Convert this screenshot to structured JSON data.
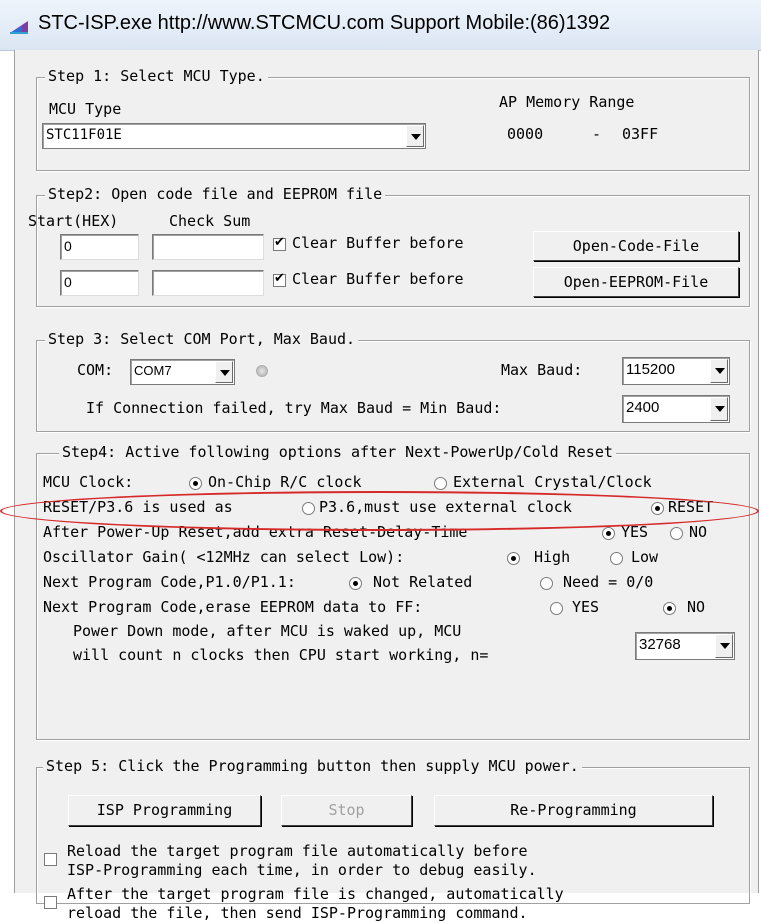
{
  "window": {
    "title": "STC-ISP.exe  http://www.STCMCU.com  Support Mobile:(86)1392",
    "icon": "stc-app-icon"
  },
  "step1": {
    "legend": "Step 1: Select MCU Type.",
    "mcu_type_label": "MCU Type",
    "mcu_type_value": "STC11F01E",
    "ap_memory_label": "AP Memory Range",
    "ap_start": "0000",
    "ap_dash": "-",
    "ap_end": "03FF"
  },
  "step2": {
    "legend": "Step2: Open code file and EEPROM file",
    "start_hex_label": "Start(HEX)",
    "check_sum_label": "Check Sum",
    "code_start": "0",
    "code_checksum": "",
    "eeprom_start": "0",
    "eeprom_checksum": "",
    "clear_buffer_label_1": "Clear Buffer before",
    "clear_buffer_label_2": "Clear Buffer before",
    "clear_buffer_1_checked": true,
    "clear_buffer_2_checked": true,
    "open_code_button": "Open-Code-File",
    "open_eeprom_button": "Open-EEPROM-File"
  },
  "step3": {
    "legend": "Step 3: Select COM Port, Max Baud.",
    "com_label": "COM:",
    "com_value": "COM7",
    "max_baud_label": "Max Baud:",
    "max_baud_value": "115200",
    "min_baud_label": "If Connection failed, try Max Baud = Min Baud:",
    "min_baud_value": "2400"
  },
  "step4": {
    "legend": "Step4: Active following options after Next-PowerUp/Cold Reset",
    "mcu_clock_label": "MCU Clock:",
    "clock_onchip": "On-Chip R/C clock",
    "clock_external": "External Crystal/Clock",
    "clock_selected": "onchip",
    "reset_label": "RESET/P3.6 is used as",
    "reset_opt_p36": "P3.6,must use external clock",
    "reset_opt_reset": "RESET",
    "reset_selected": "reset",
    "delay_label": "After Power-Up Reset,add extra Reset-Delay-Time",
    "delay_yes": "YES",
    "delay_no": "NO",
    "delay_selected": "yes",
    "gain_label": "Oscillator Gain( <12MHz can select Low):",
    "gain_high": "High",
    "gain_low": "Low",
    "gain_selected": "high",
    "p1_label": "Next Program Code,P1.0/P1.1:",
    "p1_not_related": "Not Related",
    "p1_need": "Need = 0/0",
    "p1_selected": "not_related",
    "erase_label": "Next Program Code,erase EEPROM data to FF:",
    "erase_yes": "YES",
    "erase_no": "NO",
    "erase_selected": "no",
    "pd_line1": "Power Down mode,  after MCU is waked up, MCU",
    "pd_line2": "will count n clocks then CPU start working,  n=",
    "pd_value": "32768"
  },
  "step5": {
    "legend": "Step 5: Click the Programming button then supply MCU power.",
    "isp_button": "ISP Programming",
    "stop_button": "Stop",
    "reprogram_button": "Re-Programming",
    "reload_line1": "Reload the target program file automatically before",
    "reload_line2": "ISP-Programming each time, in order to debug easily.",
    "reload_checked": false,
    "auto_line1": "After the target program file is changed, automatically",
    "auto_line2": "reload the file, then send ISP-Programming command.",
    "auto_checked": false
  },
  "highlight_color": "#d62a2a"
}
